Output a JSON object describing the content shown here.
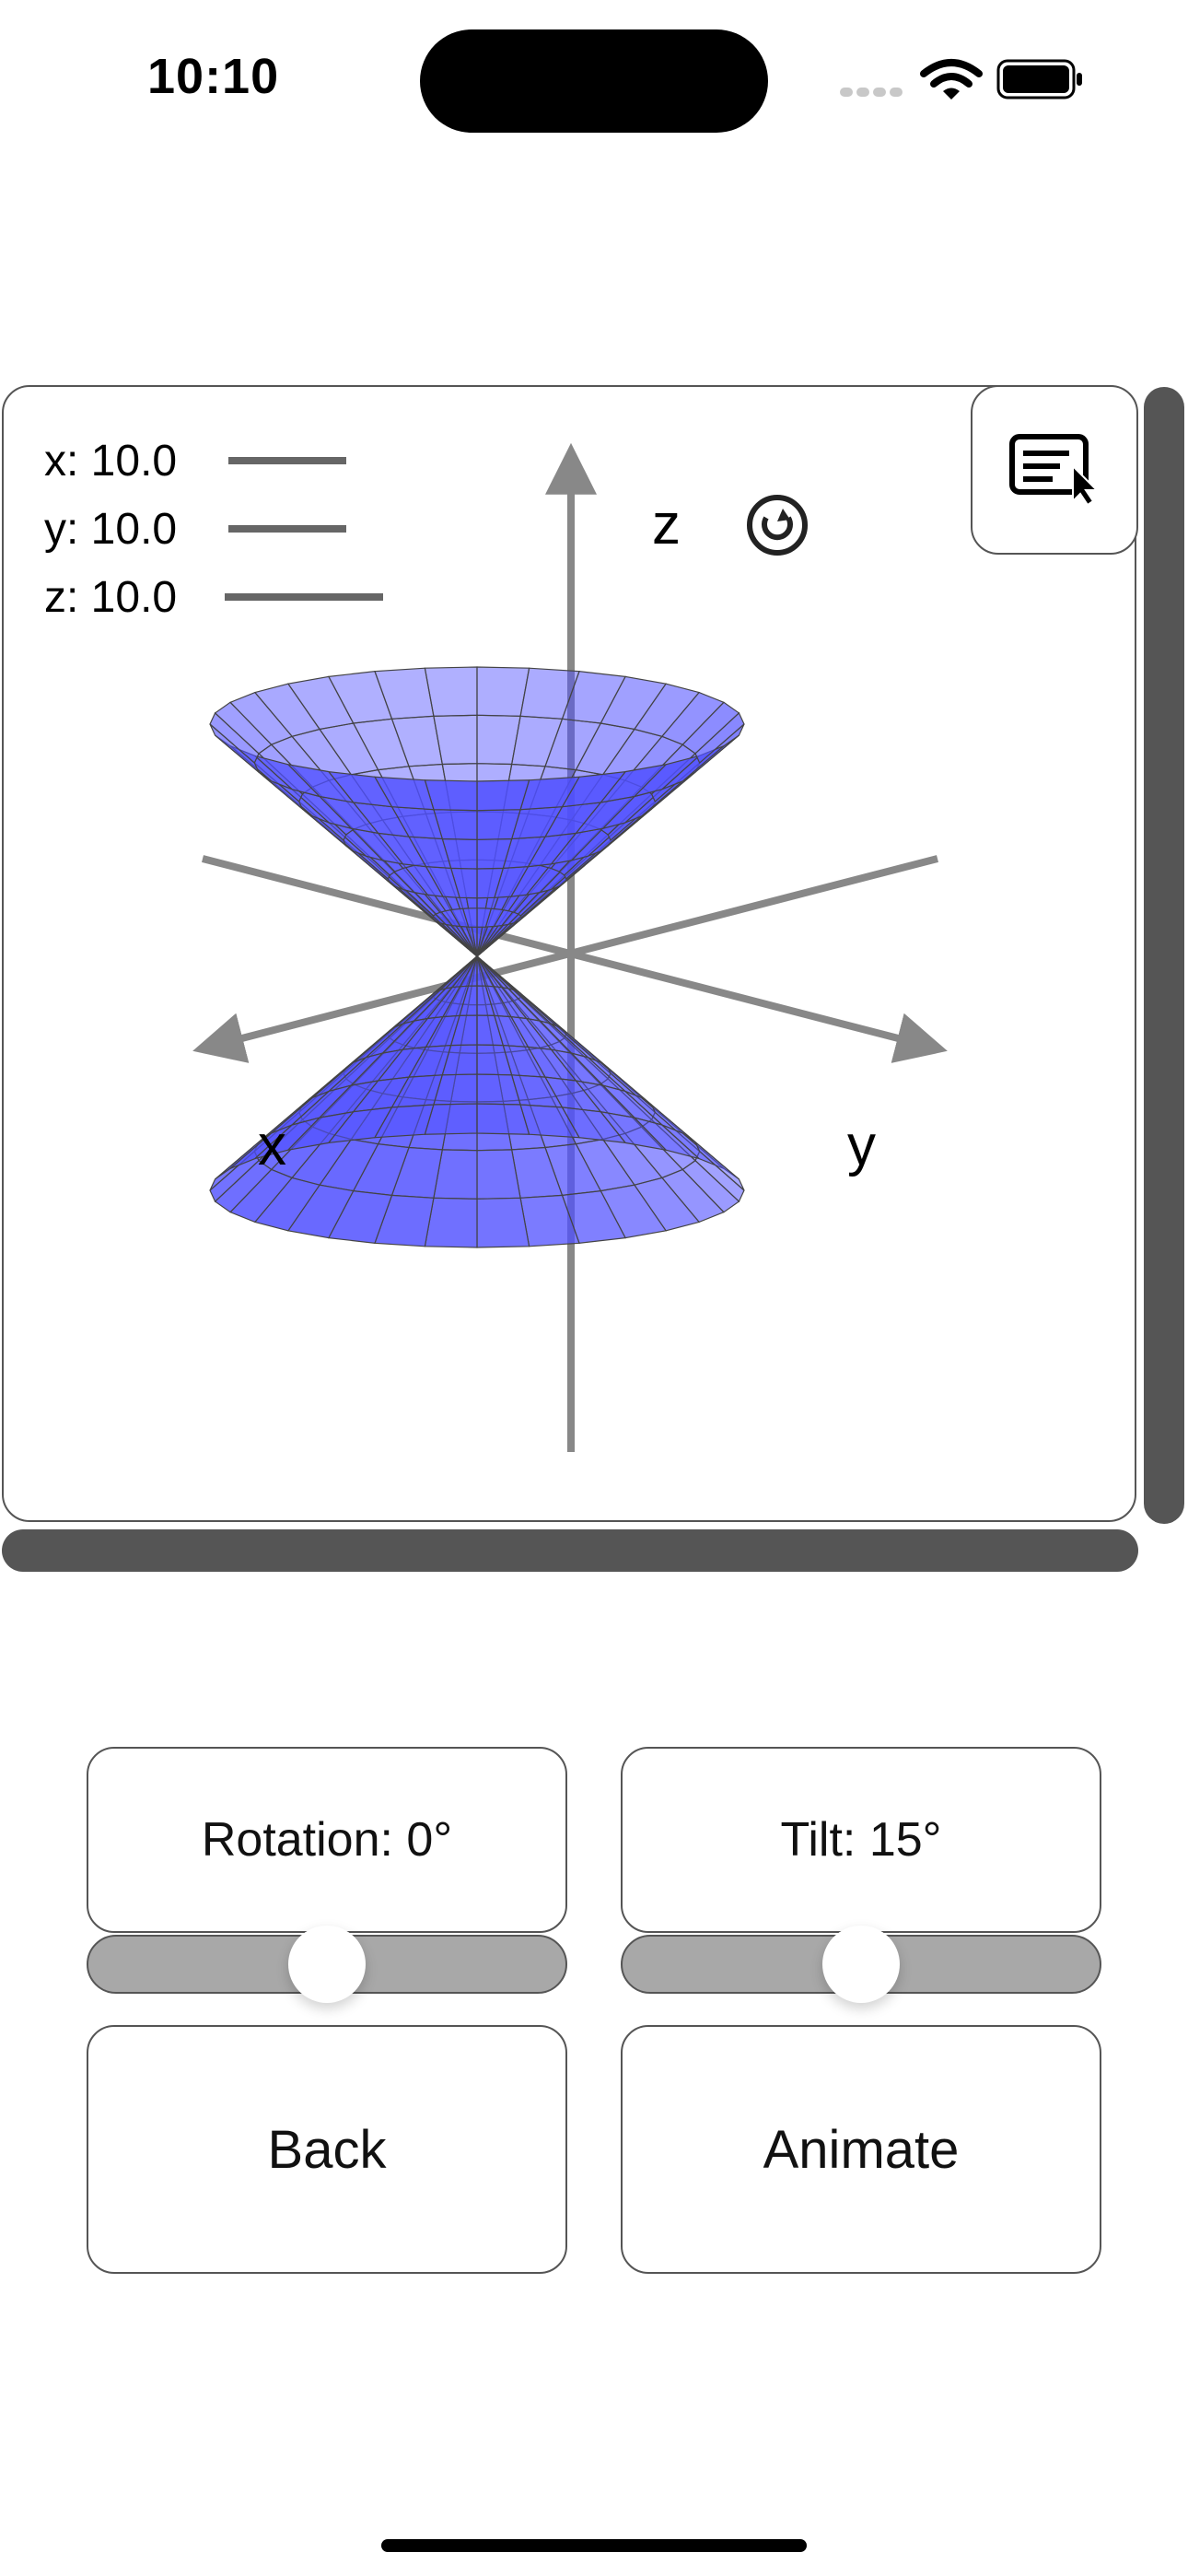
{
  "status_bar": {
    "time": "10:10"
  },
  "legend": [
    {
      "label": "x: 10.0"
    },
    {
      "label": "y: 10.0"
    },
    {
      "label": "z: 10.0"
    }
  ],
  "axes": {
    "x_label": "x",
    "y_label": "y",
    "z_label": "z"
  },
  "surface_color": "#4f4fff",
  "axis_color": "#888888",
  "controls": {
    "rotation": {
      "label": "Rotation: 0°",
      "value_deg": 0,
      "fraction": 0.5
    },
    "tilt": {
      "label": "Tilt: 15°",
      "value_deg": 15,
      "fraction": 0.5
    },
    "back_label": "Back",
    "animate_label": "Animate"
  }
}
